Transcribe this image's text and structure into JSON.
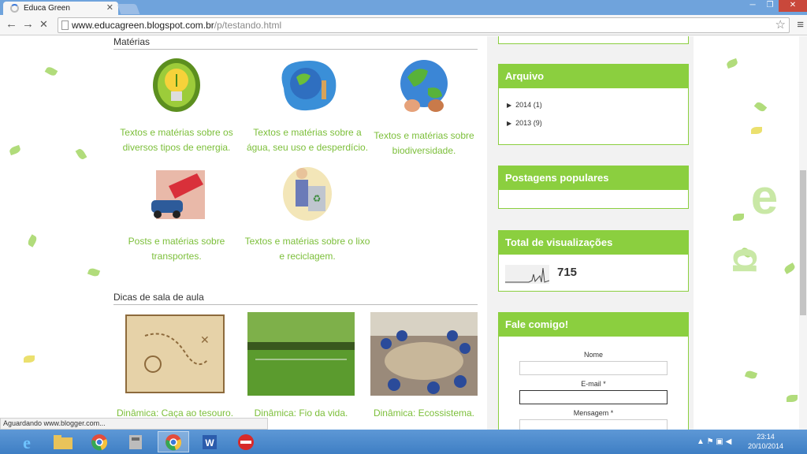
{
  "browser": {
    "tab_title": "Educa Green",
    "url_host": "www.educagreen.blogspot.com.br",
    "url_path": "/p/testando.html"
  },
  "main": {
    "materias_title": "Matérias",
    "topics": [
      {
        "caption": "Textos e matérias sobre os diversos tipos de energia."
      },
      {
        "caption": "Textos e matérias sobre a água, seu uso e desperdício."
      },
      {
        "caption": "Textos e matérias sobre biodiversidade."
      },
      {
        "caption": "Posts e matérias sobre transportes."
      },
      {
        "caption": "Textos e matérias sobre o lixo e reciclagem."
      }
    ],
    "dicas_title": "Dicas de sala de aula",
    "dicas": [
      {
        "caption": "Dinâmica: Caça ao tesouro."
      },
      {
        "caption": "Dinâmica: Fio da vida."
      },
      {
        "caption": "Dinâmica: Ecossistema."
      }
    ]
  },
  "sidebar": {
    "arquivo_title": "Arquivo",
    "arquivo_items": [
      {
        "year": "2014",
        "count": "(1)"
      },
      {
        "year": "2013",
        "count": "(9)"
      }
    ],
    "populares_title": "Postagens populares",
    "visualizacoes_title": "Total de visualizações",
    "visualizacoes_count": "715",
    "contato_title": "Fale comigo!",
    "form_nome": "Nome",
    "form_email": "E-mail *",
    "form_mensagem": "Mensagem *"
  },
  "status_text": "Aguardando www.blogger.com...",
  "taskbar": {
    "time": "23:14",
    "date": "20/10/2014"
  },
  "colors": {
    "accent": "#8bcf3f",
    "caption": "#7cbf3a"
  }
}
